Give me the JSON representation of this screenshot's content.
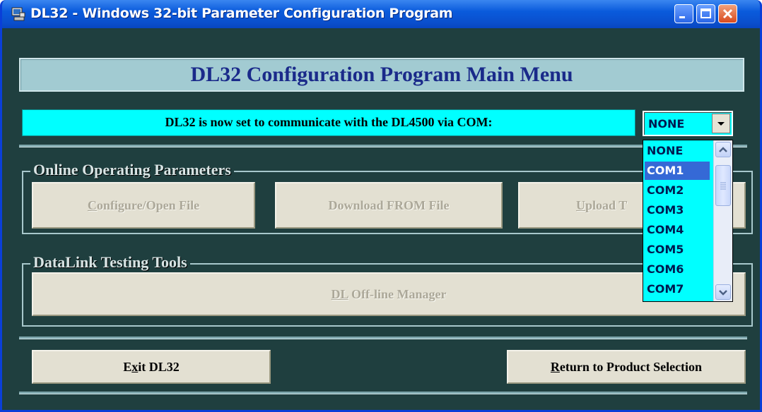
{
  "window": {
    "title": "DL32 - Windows 32-bit Parameter Configuration Program"
  },
  "header": {
    "title": "DL32 Configuration Program Main Menu"
  },
  "com": {
    "status_text": "DL32 is now set to communicate with the DL4500 via COM:",
    "selected_value": "NONE",
    "options": [
      "NONE",
      "COM1",
      "COM2",
      "COM3",
      "COM4",
      "COM5",
      "COM6",
      "COM7"
    ],
    "highlighted_option": "COM1"
  },
  "online_group": {
    "title": "Online Operating Parameters",
    "configure_button": {
      "mnemonic": "C",
      "rest": "onfigure/Open File",
      "enabled": false
    },
    "download_button": {
      "label": "Download FROM File",
      "enabled": false
    },
    "upload_button": {
      "mnemonic": "U",
      "rest": "pload T",
      "enabled": false
    }
  },
  "testing_group": {
    "title": "DataLink Testing Tools",
    "offline_manager_button": {
      "mnemonic": "DL",
      "rest": " Off-line Manager",
      "enabled": false
    }
  },
  "footer": {
    "exit_button": {
      "pre": "E",
      "mnemonic": "x",
      "rest": "it DL32"
    },
    "return_button": {
      "mnemonic": "R",
      "rest": "eturn to Product Selection"
    }
  },
  "colors": {
    "window_bg": "#1f3f3f",
    "title_bar": "#0a5bdc",
    "status_bg": "#00ffff",
    "header_bg": "#a2cbd2",
    "header_text": "#1a2a8a"
  }
}
